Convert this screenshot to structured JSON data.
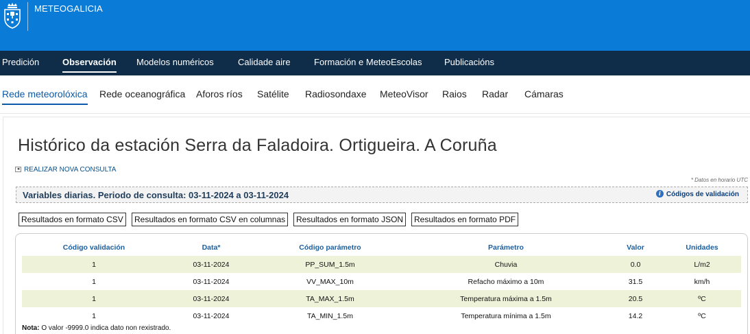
{
  "header": {
    "brand": "METEOGALICIA",
    "colors": {
      "top": "#0a7bd6",
      "nav": "#0f2d48",
      "accent": "#0a5aa8",
      "row_stripe": "#eef2d9"
    },
    "logo_icon": "xunta-galicia-emblem"
  },
  "main_nav": {
    "items": [
      {
        "label": "Predición"
      },
      {
        "label": "Observación"
      },
      {
        "label": "Modelos numéricos"
      },
      {
        "label": "Calidade aire"
      },
      {
        "label": "Formación e MeteoEscolas"
      },
      {
        "label": "Publicacións"
      }
    ],
    "active": "Observación"
  },
  "sub_nav": {
    "items": [
      {
        "label": "Rede meteorolóxica"
      },
      {
        "label": "Rede oceanográfica"
      },
      {
        "label": "Aforos ríos"
      },
      {
        "label": "Satélite"
      },
      {
        "label": "Radiosondaxe"
      },
      {
        "label": "MeteoVisor"
      },
      {
        "label": "Raios"
      },
      {
        "label": "Radar"
      },
      {
        "label": "Cámaras"
      }
    ],
    "active": "Rede meteorolóxica"
  },
  "page": {
    "title": "Histórico da estación Serra da Faladoira. Ortigueira. A Coruña",
    "back_link": "REALIZAR NOVA CONSULTA",
    "utc_note": "* Datos en horario UTC",
    "period": "Variables diarias. Periodo de consulta: 03-11-2024 a 03-11-2024",
    "validation_link": "Códigos de validación"
  },
  "buttons": {
    "csv": "Resultados en formato CSV",
    "csv_cols": "Resultados en formato CSV en columnas",
    "json": "Resultados en formato JSON",
    "pdf": "Resultados en formato PDF"
  },
  "table": {
    "headers": {
      "validation": "Código validación",
      "date": "Data*",
      "param_code": "Código parámetro",
      "param": "Parámetro",
      "value": "Valor",
      "units": "Unidades"
    },
    "rows": [
      {
        "validation": "1",
        "date": "03-11-2024",
        "param_code": "PP_SUM_1.5m",
        "param": "Chuvia",
        "value": "0.0",
        "units": "L/m2"
      },
      {
        "validation": "1",
        "date": "03-11-2024",
        "param_code": "VV_MAX_10m",
        "param": "Refacho máximo a 10m",
        "value": "31.5",
        "units": "km/h"
      },
      {
        "validation": "1",
        "date": "03-11-2024",
        "param_code": "TA_MAX_1.5m",
        "param": "Temperatura máxima a 1.5m",
        "value": "20.5",
        "units": "ºC"
      },
      {
        "validation": "1",
        "date": "03-11-2024",
        "param_code": "TA_MIN_1.5m",
        "param": "Temperatura mínima a 1.5m",
        "value": "14.2",
        "units": "ºC"
      }
    ]
  },
  "note": {
    "label": "Nota:",
    "text": " O valor -9999.0 indica dato non rexistrado."
  }
}
